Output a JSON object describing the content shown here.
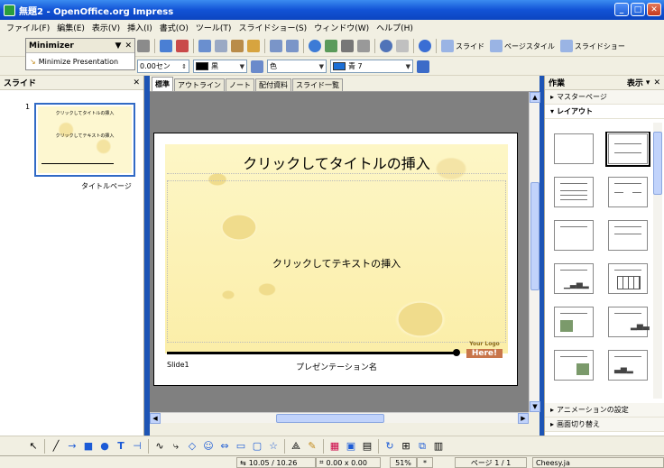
{
  "window": {
    "title": "無題2 - OpenOffice.org Impress"
  },
  "menu": [
    "ファイル(F)",
    "編集(E)",
    "表示(V)",
    "挿入(I)",
    "書式(O)",
    "ツール(T)",
    "スライドショー(S)",
    "ウィンドウ(W)",
    "ヘルプ(H)"
  ],
  "toolbar": {
    "slide_label": "スライド",
    "page_style_label": "ページスタイル",
    "slideshow_label": "スライドショー"
  },
  "minimizer": {
    "title": "Minimizer",
    "item": "Minimize Presentation"
  },
  "format_bar": {
    "line_width": "0.00セン",
    "line_color": "黒",
    "area_label": "色",
    "area_color": "青 7"
  },
  "colors": {
    "line_color": "#000000",
    "area_color": "#1c6fd6",
    "selection": "#316ac5"
  },
  "slides_panel": {
    "title": "スライド",
    "slides": [
      {
        "number": "1",
        "label": "タイトルページ",
        "thumb_title": "クリックしてタイトルの挿入",
        "thumb_body": "クリックしてテキストの挿入"
      }
    ]
  },
  "view_tabs": [
    "標準",
    "アウトライン",
    "ノート",
    "配付資料",
    "スライド一覧"
  ],
  "slide": {
    "title": "クリックしてタイトルの挿入",
    "body": "クリックしてテキストの挿入",
    "footer_left": "Slide1",
    "footer_center": "プレゼンテーション名",
    "logo_top": "Your Logo",
    "logo_bottom": "Here!"
  },
  "tasks_panel": {
    "title": "作業",
    "view_menu": "表示",
    "master_pages": "マスターページ",
    "layouts": "レイアウト",
    "animation": "アニメーションの設定",
    "transition": "画面切り替え"
  },
  "status": {
    "position": "10.05 / 10.26",
    "size": "0.00 x 0.00",
    "zoom": "51%",
    "modified": "*",
    "page": "ページ 1 / 1",
    "style": "Cheesy.ja"
  }
}
